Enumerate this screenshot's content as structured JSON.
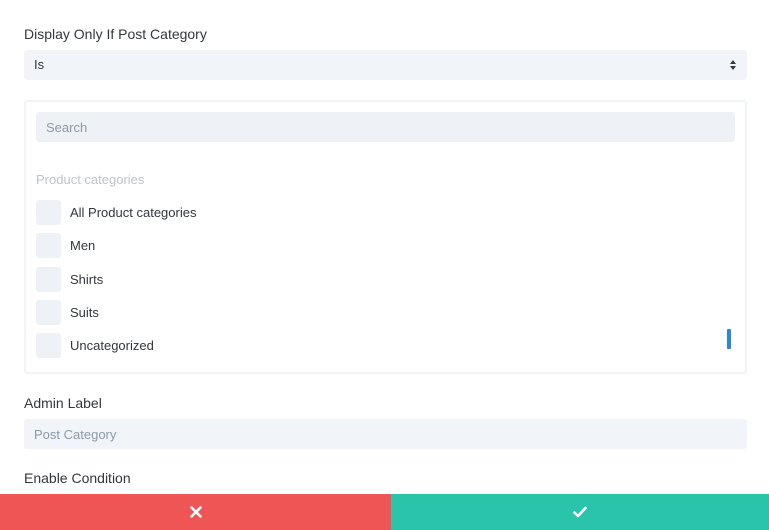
{
  "condition": {
    "label": "Display Only If Post Category",
    "operator": "Is"
  },
  "categories_panel": {
    "search_placeholder": "Search",
    "group_heading": "Product categories",
    "items": [
      {
        "label": "All Product categories",
        "checked": false
      },
      {
        "label": "Men",
        "checked": false
      },
      {
        "label": "Shirts",
        "checked": false
      },
      {
        "label": "Suits",
        "checked": false
      },
      {
        "label": "Uncategorized",
        "checked": false
      }
    ]
  },
  "admin_label": {
    "label": "Admin Label",
    "placeholder": "Post Category"
  },
  "enable_condition": {
    "label": "Enable Condition"
  },
  "actions": {
    "cancel_icon": "close-icon",
    "save_icon": "checkmark-icon"
  },
  "colors": {
    "cancel": "#ef5555",
    "save": "#29c4a9",
    "scrollbar": "#2b87da",
    "field_bg": "#f1f5f9"
  }
}
